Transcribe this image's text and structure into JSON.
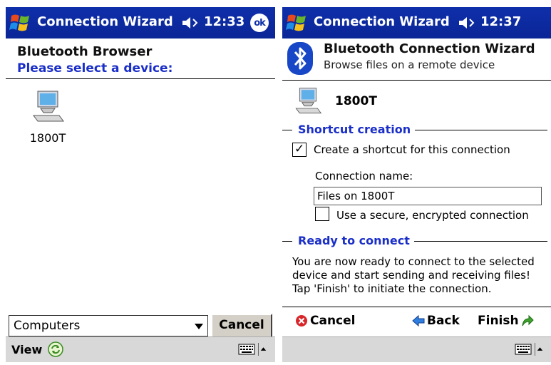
{
  "left": {
    "app_title": "Connection Wizard",
    "clock": "12:33",
    "ok_label": "ok",
    "heading": "Bluetooth Browser",
    "subheading": "Please select a device:",
    "devices": [
      {
        "label": "1800T",
        "icon": "computer-icon"
      }
    ],
    "filter_combo": {
      "value": "Computers"
    },
    "cancel_label": "Cancel",
    "menu": {
      "view_label": "View"
    }
  },
  "right": {
    "app_title": "Connection Wizard",
    "clock": "12:37",
    "heading": "Bluetooth Connection Wizard",
    "subheading": "Browse files on a remote device",
    "device_name": "1800T",
    "shortcut": {
      "group_title": "Shortcut creation",
      "create_label": "Create a shortcut for this connection",
      "create_checked": true,
      "name_label": "Connection name:",
      "name_value": "Files on 1800T",
      "secure_label": "Use a secure, encrypted connection",
      "secure_checked": false
    },
    "ready": {
      "group_title": "Ready to connect",
      "text": "You are now ready to connect to the selected device and start sending and receiving files! Tap 'Finish' to initiate the connection."
    },
    "commands": {
      "cancel": "Cancel",
      "back": "Back",
      "finish": "Finish"
    }
  },
  "colors": {
    "titlebar": "#0f2faa",
    "accent_text": "#1a2ec8",
    "menubar": "#d8d8d8"
  }
}
